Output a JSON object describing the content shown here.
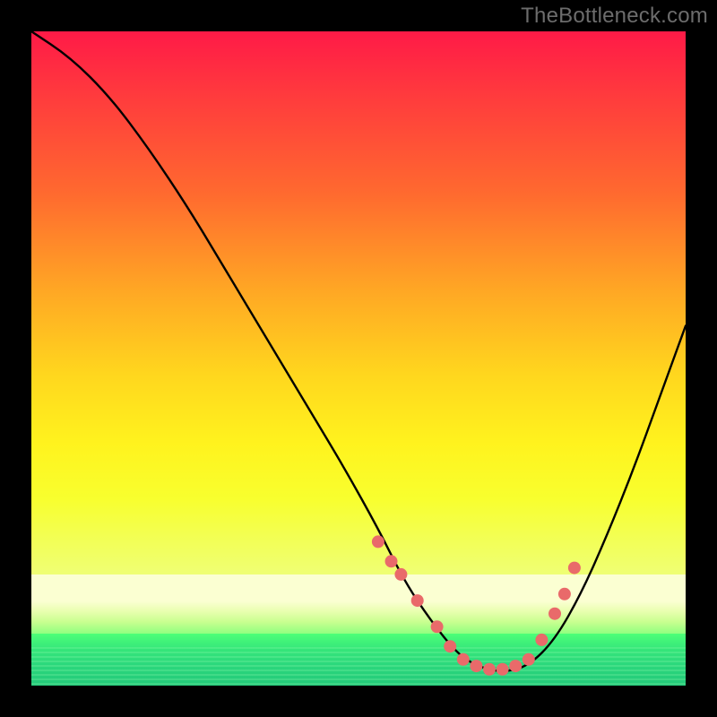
{
  "watermark": "TheBottleneck.com",
  "colors": {
    "background": "#000000",
    "curve": "#000000",
    "marker": "#e96a6a",
    "gradient_top": "#ff1a47",
    "gradient_mid": "#fff31e",
    "gradient_bottom": "#23c97a"
  },
  "chart_data": {
    "type": "line",
    "title": "",
    "xlabel": "",
    "ylabel": "",
    "xlim": [
      0,
      100
    ],
    "ylim": [
      0,
      100
    ],
    "grid": false,
    "legend": false,
    "series": [
      {
        "name": "bottleneck-curve",
        "x": [
          0,
          6,
          12,
          18,
          24,
          30,
          36,
          42,
          48,
          53,
          57,
          61,
          65,
          68,
          72,
          76,
          80,
          84,
          88,
          92,
          96,
          100
        ],
        "y": [
          100,
          96,
          90,
          82,
          73,
          63,
          53,
          43,
          33,
          24,
          16,
          10,
          5,
          3,
          2,
          3,
          7,
          14,
          23,
          33,
          44,
          55
        ]
      }
    ],
    "markers": {
      "name": "highlight-points",
      "x": [
        53,
        55,
        56.5,
        59,
        62,
        64,
        66,
        68,
        70,
        72,
        74,
        76,
        78,
        80,
        81.5,
        83
      ],
      "y": [
        22,
        19,
        17,
        13,
        9,
        6,
        4,
        3,
        2.5,
        2.5,
        3,
        4,
        7,
        11,
        14,
        18
      ]
    }
  }
}
